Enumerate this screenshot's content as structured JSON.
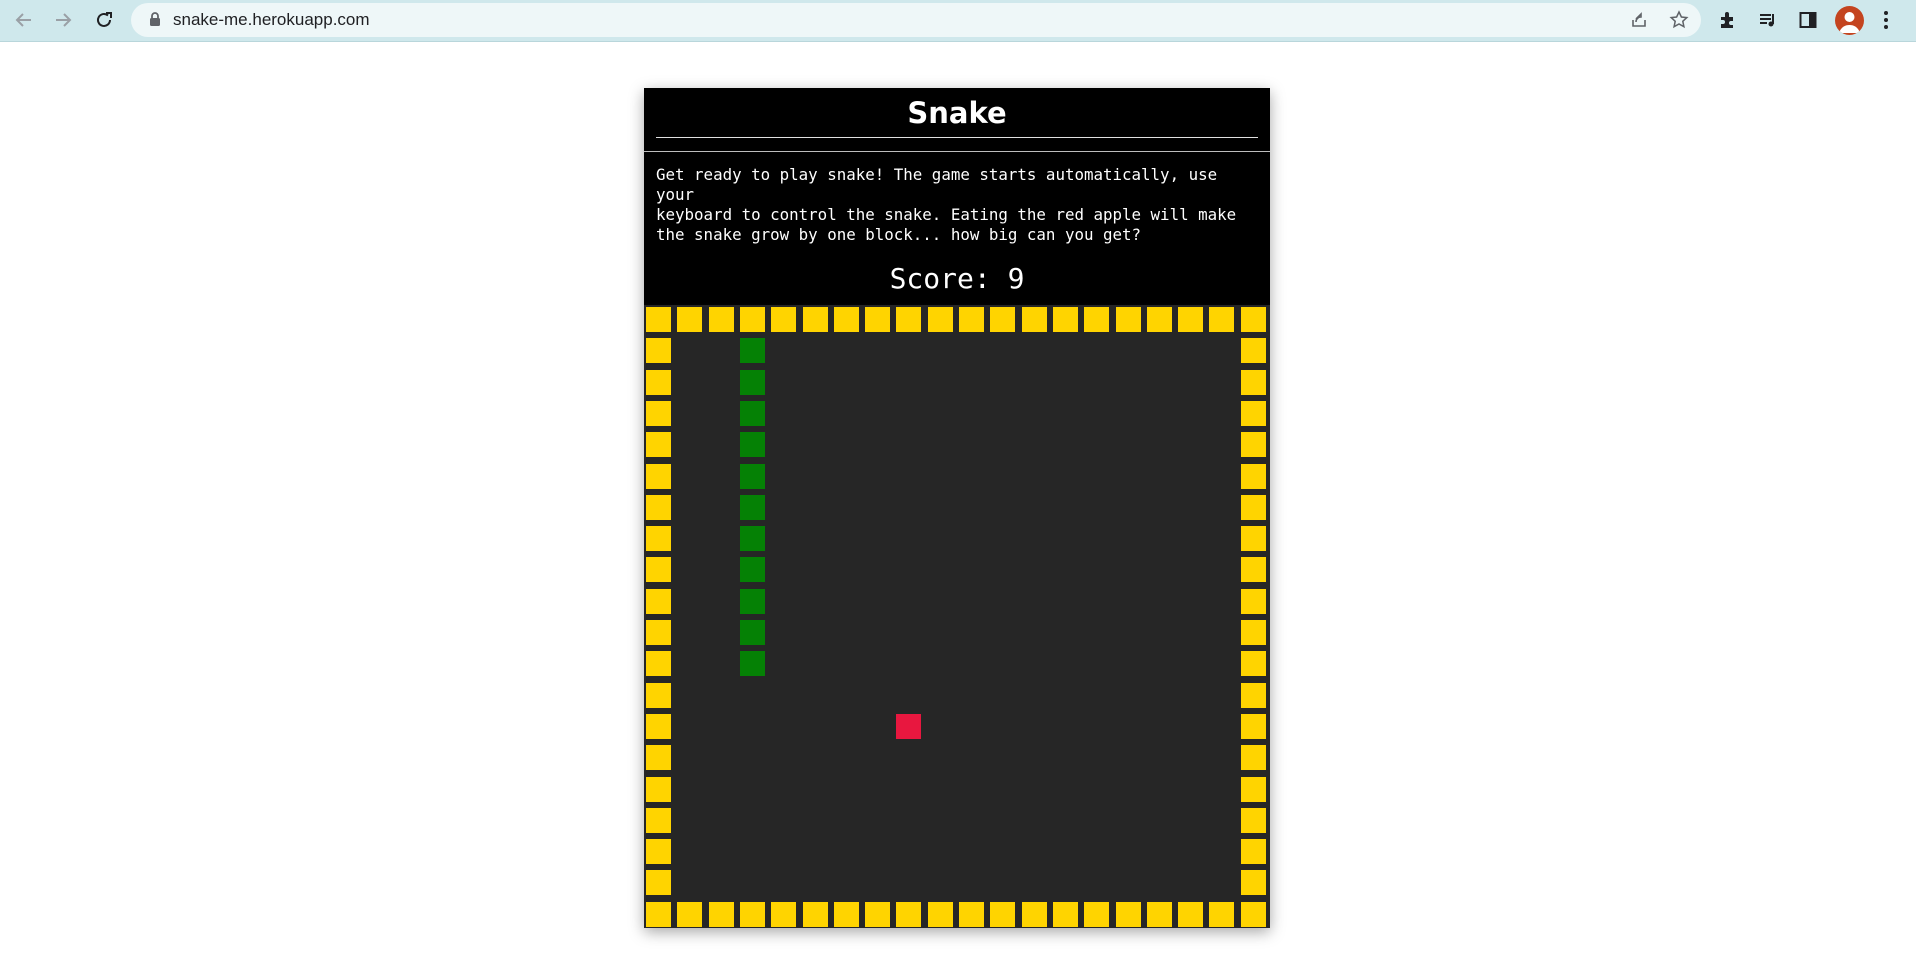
{
  "browser": {
    "url": "snake-me.herokuapp.com",
    "icons": [
      "back-icon",
      "forward-icon",
      "reload-icon",
      "lock-icon",
      "share-icon",
      "star-icon",
      "extensions-icon",
      "media-icon",
      "side-panel-icon",
      "profile-avatar",
      "menu-icon"
    ]
  },
  "game": {
    "title": "Snake",
    "intro": "Get ready to play snake! The game starts automatically, use your\nkeyboard to control the snake. Eating the red apple will make\nthe snake grow by one block... how big can you get?",
    "score_text": "Score: 9",
    "score": 9,
    "board": {
      "columns": 20,
      "rows": 20,
      "wall_color": "#ffd400",
      "snake_color": "#058105",
      "apple_color": "#e8173f",
      "background_color": "#262626",
      "snake_cells": [
        [
          3,
          1
        ],
        [
          3,
          2
        ],
        [
          3,
          3
        ],
        [
          3,
          4
        ],
        [
          3,
          5
        ],
        [
          3,
          6
        ],
        [
          3,
          7
        ],
        [
          3,
          8
        ],
        [
          3,
          9
        ],
        [
          3,
          10
        ],
        [
          3,
          11
        ]
      ],
      "apple_cell": [
        8,
        13
      ]
    }
  }
}
